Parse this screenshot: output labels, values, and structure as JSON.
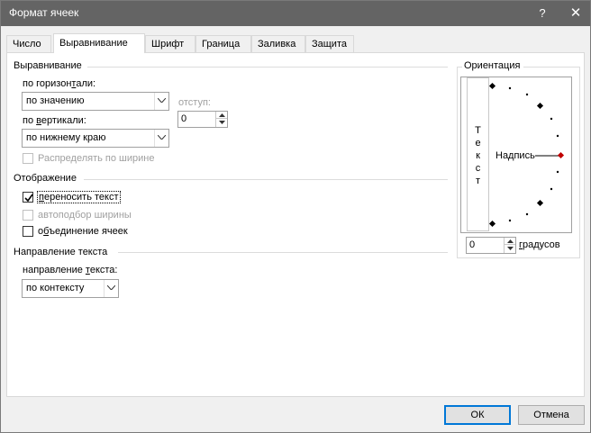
{
  "window": {
    "title": "Формат ячеек",
    "help_glyph": "?",
    "close_glyph": "✕"
  },
  "tabs": [
    {
      "label": "Число"
    },
    {
      "label": "Выравнивание"
    },
    {
      "label": "Шрифт"
    },
    {
      "label": "Граница"
    },
    {
      "label": "Заливка"
    },
    {
      "label": "Защита"
    }
  ],
  "active_tab": "Выравнивание",
  "alignment": {
    "title": "Выравнивание",
    "horizontal_label_pre": "по горизон",
    "horizontal_label_key": "т",
    "horizontal_label_post": "али:",
    "horizontal_value": "по значению",
    "vertical_label_pre": "по ",
    "vertical_label_key": "в",
    "vertical_label_post": "ертикали:",
    "vertical_value": "по нижнему краю",
    "indent_label": "отступ:",
    "indent_value": "0",
    "distributed_label": "Распределять по ширине"
  },
  "display": {
    "title": "Отображение",
    "wrap_label_key": "п",
    "wrap_label_post": "ереносить текст",
    "wrap_checked": true,
    "shrink_label": "автоподбор ширины",
    "shrink_checked": false,
    "merge_label_pre": "о",
    "merge_label_key": "б",
    "merge_label_post": "ъединение ячеек",
    "merge_checked": false
  },
  "direction": {
    "title": "Направление текста",
    "label_pre": "направление ",
    "label_key": "т",
    "label_post": "екста:",
    "value": "по контексту"
  },
  "orientation": {
    "title": "Ориентация",
    "vertical_text": [
      "Т",
      "е",
      "к",
      "с",
      "т"
    ],
    "label": "Надпись",
    "degrees_value": "0",
    "degrees_label_key": "г",
    "degrees_label_post": "радусов"
  },
  "buttons": {
    "ok": "ОК",
    "cancel": "Отмена"
  },
  "colors": {
    "titlebar": "#646464",
    "ok_border": "#0078d7",
    "orientation_marker": "#c00000"
  }
}
